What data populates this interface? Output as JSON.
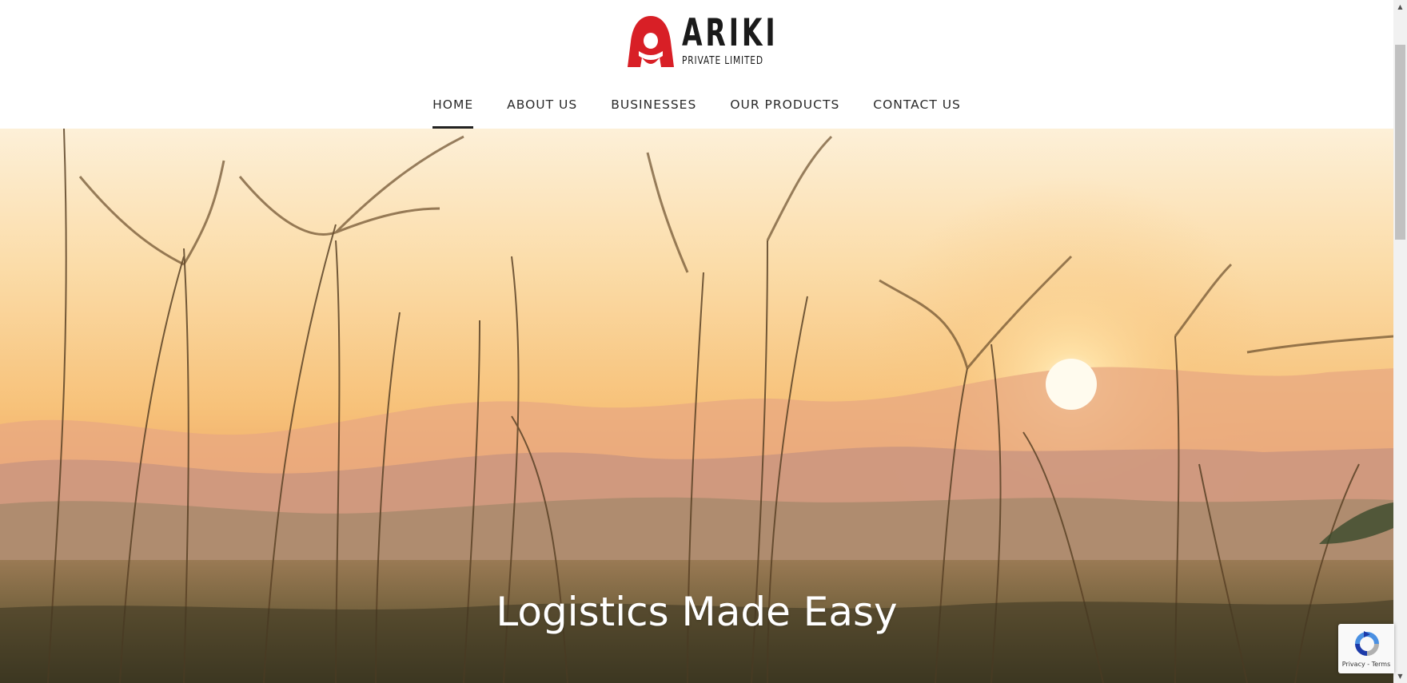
{
  "brand": {
    "name": "ARIKI",
    "subtitle": "PRIVATE LIMITED",
    "logo_icon": "ariki-logo-icon",
    "accent_color": "#d81f26"
  },
  "nav": {
    "items": [
      {
        "label": "HOME",
        "active": true
      },
      {
        "label": "ABOUT US",
        "active": false
      },
      {
        "label": "BUSINESSES",
        "active": false
      },
      {
        "label": "OUR PRODUCTS",
        "active": false
      },
      {
        "label": "CONTACT US",
        "active": false
      }
    ]
  },
  "hero": {
    "title": "Logistics Made Easy",
    "background": "sunset-grass-field-photo"
  },
  "recaptcha": {
    "privacy": "Privacy",
    "separator": " - ",
    "terms": "Terms",
    "icon": "recaptcha-icon"
  },
  "scrollbar": {
    "up_icon": "scroll-up-arrow-icon",
    "down_icon": "scroll-down-arrow-icon"
  }
}
